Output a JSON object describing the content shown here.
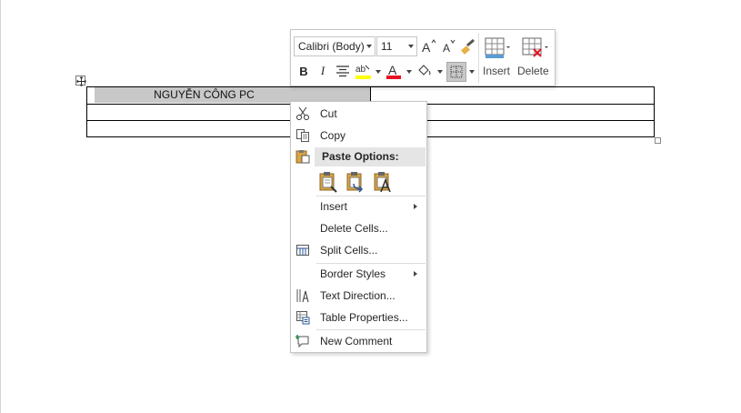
{
  "table": {
    "cell_text": "NGUYỄN CÔNG PC"
  },
  "mini_toolbar": {
    "font_name": "Calibri (Body)",
    "font_size": "11",
    "insert_label": "Insert",
    "delete_label": "Delete",
    "bold_label": "B",
    "italic_label": "I",
    "grow_font_label": "A",
    "shrink_font_label": "A",
    "font_color_label": "A",
    "highlight_label": "ab",
    "colors": {
      "font_color": "#e81123",
      "highlight": "#ffff00",
      "accent": "#2b579a"
    }
  },
  "context_menu": {
    "cut": "Cut",
    "copy": "Copy",
    "paste_options": "Paste Options:",
    "insert": "Insert",
    "delete_cells": "Delete Cells...",
    "split_cells": "Split Cells...",
    "border_styles": "Border Styles",
    "text_direction": "Text Direction...",
    "table_properties": "Table Properties...",
    "new_comment": "New Comment"
  }
}
